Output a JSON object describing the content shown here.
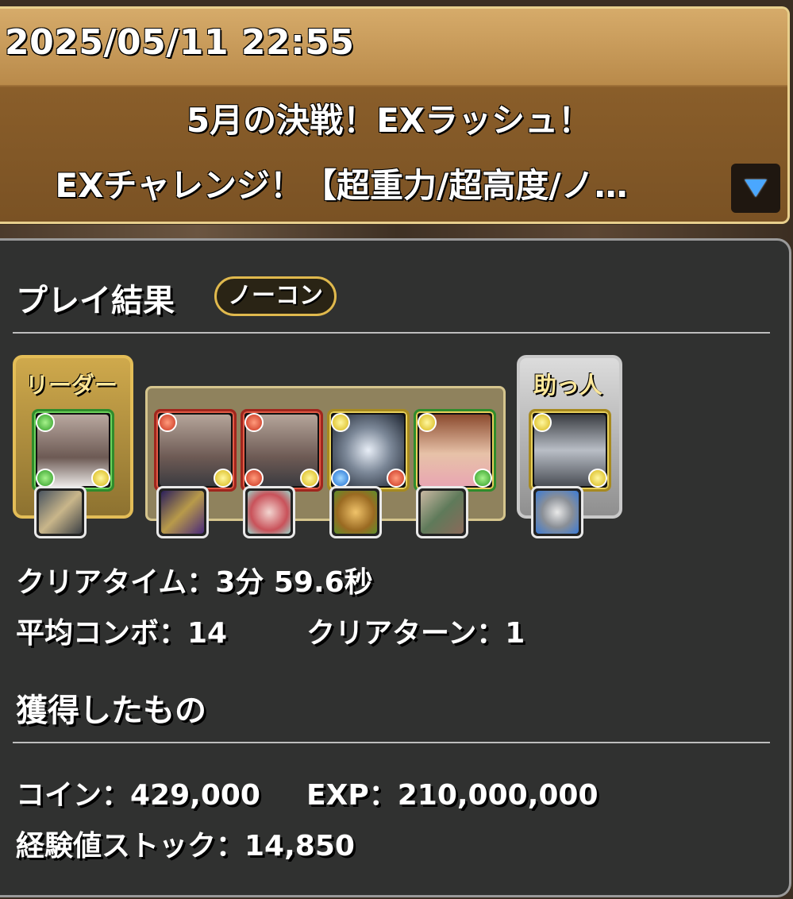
{
  "header": {
    "datetime": "2025/05/11 22:55",
    "title_line1": "5月の決戦！EXラッシュ！",
    "title_line2": "EXチャレンジ！【超重力/超高度/ノ…"
  },
  "result": {
    "heading": "プレイ結果",
    "badge": "ノーコン",
    "leader_label": "リーダー",
    "helper_label": "助っ人",
    "clear_time": "クリアタイム：3分 59.6秒",
    "avg_combo": "平均コンボ：14",
    "clear_turn": "クリアターン：1"
  },
  "rewards": {
    "heading": "獲得したもの",
    "coin": "コイン：429,000",
    "exp": "EXP：210,000,000",
    "exp_stock": "経験値ストック：14,850"
  },
  "colors": {
    "accent_gold": "#e3bd57",
    "panel_bg": "#303130",
    "expand_arrow": "#4aa7ff"
  },
  "icons": [
    "caret-down-icon"
  ]
}
